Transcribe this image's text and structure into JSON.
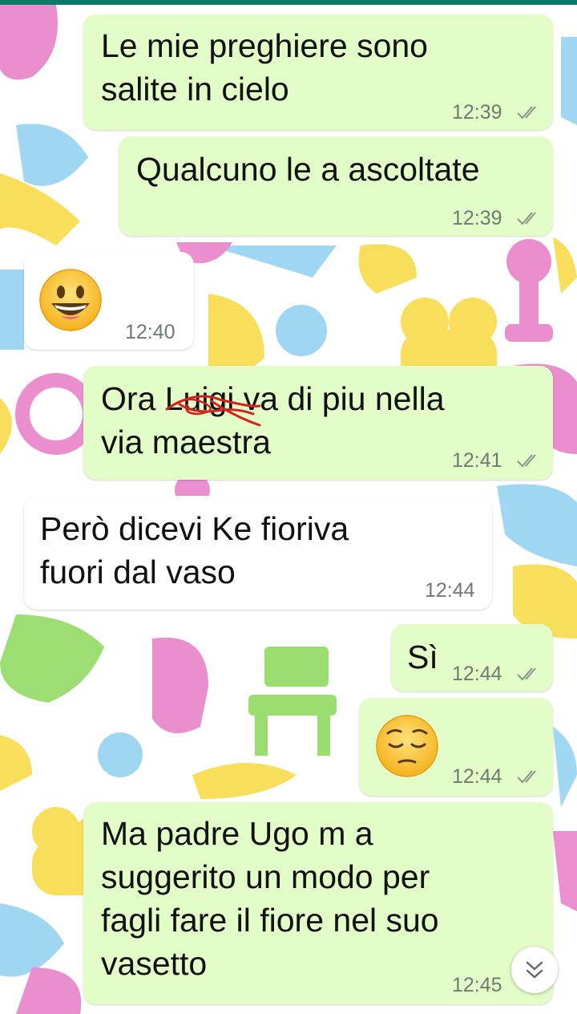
{
  "chat": {
    "messages": [
      {
        "direction": "out",
        "text": "Le mie preghiere sono\nsalite in cielo",
        "time": "12:39",
        "status": "delivered-double-check"
      },
      {
        "direction": "out",
        "text": "Qualcuno le a ascoltate",
        "time": "12:39",
        "status": "delivered-double-check"
      },
      {
        "direction": "in",
        "emoji": "grinning-face",
        "time": "12:40"
      },
      {
        "direction": "out",
        "text_before": "Ora ",
        "text_strike": "Luigi",
        "text_after": " va di piu nella\nvia maestra",
        "time": "12:41",
        "status": "delivered-double-check"
      },
      {
        "direction": "in",
        "text": "Però dicevi Ke fioriva\nfuori dal vaso",
        "time": "12:44"
      },
      {
        "direction": "out",
        "text": "Sì",
        "time": "12:44",
        "status": "delivered-double-check"
      },
      {
        "direction": "out",
        "emoji": "pensive-face",
        "time": "12:44",
        "status": "delivered-double-check"
      },
      {
        "direction": "out",
        "text": "Ma padre Ugo m a\nsuggerito un modo per\nfagli fare il fiore nel suo\nvasetto",
        "time": "12:45",
        "status": "delivered-double-check"
      }
    ]
  },
  "colors": {
    "outgoing_bubble": "#e2fdc8",
    "incoming_bubble": "#ffffff",
    "top_bar": "#0b7a68",
    "timestamp": "#6f7a70",
    "scribble": "#d9201d"
  },
  "icons": {
    "tick": "double-check-icon",
    "scroll": "scroll-to-bottom-icon"
  }
}
